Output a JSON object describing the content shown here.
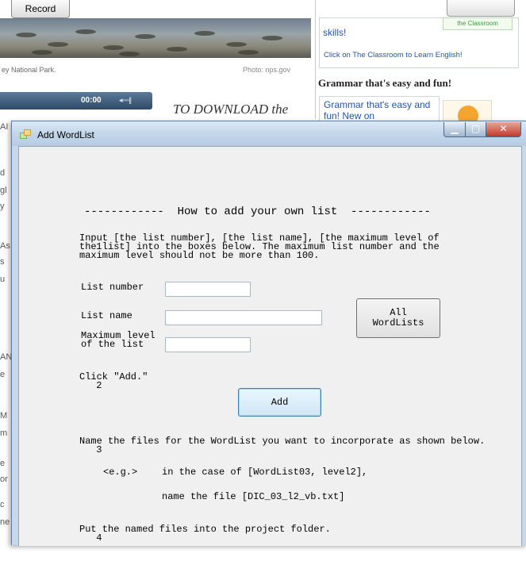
{
  "background": {
    "record_button": "Record",
    "photo_credit": "Photo: nps.gov",
    "park_caption": "ey National Park.",
    "player_time": "00:00",
    "player_volume": "◂◦◦◦◦||",
    "download_text": "TO DOWNLOAD the",
    "skills_text": "skills!",
    "classroom_link": "Click on The Classroom to Learn English!",
    "classroom_badge": "the Classroom",
    "grammar_heading": "Grammar that's easy and fun!",
    "grammar_text": "Grammar that's easy and fun! New on",
    "left_edge_fragments": [
      "AI",
      "d",
      "gl",
      "y",
      "As",
      "s",
      "u",
      "AN",
      "e",
      "M",
      "m",
      "e",
      "or",
      "c",
      "ne"
    ]
  },
  "window": {
    "title": "Add WordList",
    "icon": "app-form-icon",
    "controls": {
      "minimize": "▁",
      "maximize": "▢",
      "close": "✕"
    }
  },
  "content": {
    "heading": "------------  How to add your own list  ------------",
    "step1": {
      "number": "1",
      "text": "Input [the list number], [the list name], [the maximum level of\nthe list] into the boxes below. The maximum list number and the\nmaximum level should not be more than 100."
    },
    "fields": {
      "list_number": {
        "label": "List number",
        "value": ""
      },
      "list_name": {
        "label": "List name",
        "value": ""
      },
      "max_level": {
        "label": "Maximum level\nof the list",
        "value": ""
      }
    },
    "all_wordlists_button": "All\nWordLists",
    "step2": {
      "number": "2",
      "text": "Click \"Add.\""
    },
    "add_button": "Add",
    "step3": {
      "number": "3",
      "text": "Name the files for the WordList you want to incorporate as shown below."
    },
    "example": {
      "tag": "<e.g.>",
      "case_text": "in the case of [WordList03, level2],",
      "file_text": "name the file [DIC_03_l2_vb.txt]"
    },
    "step4": {
      "number": "4",
      "text": "Put the named files into the project folder."
    }
  }
}
